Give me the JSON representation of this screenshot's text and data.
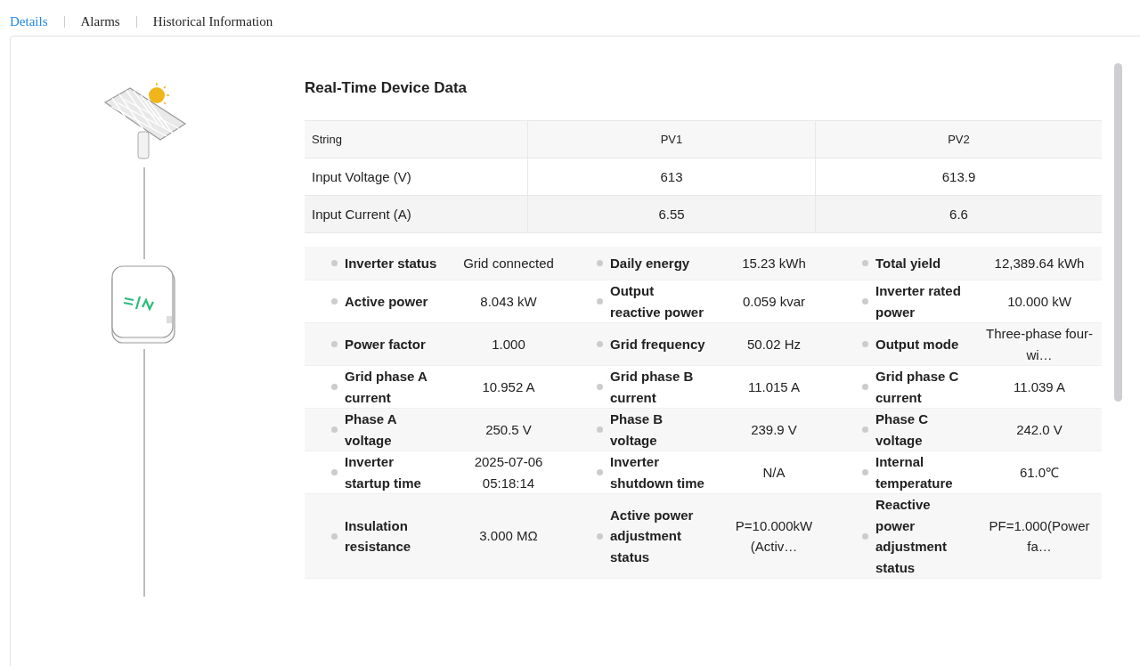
{
  "tabs": [
    {
      "label": "Details",
      "selected": true
    },
    {
      "label": "Alarms",
      "selected": false
    },
    {
      "label": "Historical Information",
      "selected": false
    }
  ],
  "title": "Real-Time Device Data",
  "string_table": {
    "columns": [
      "String",
      "PV1",
      "PV2"
    ],
    "rows": [
      [
        "Input Voltage (V)",
        "613",
        "613.9"
      ],
      [
        "Input Current (A)",
        "6.55",
        "6.6"
      ]
    ]
  },
  "parameters": [
    [
      {
        "label": "Inverter status",
        "value": "Grid connected"
      },
      {
        "label": "Daily energy",
        "value": "15.23 kWh"
      },
      {
        "label": "Total yield",
        "value": "12,389.64 kWh"
      }
    ],
    [
      {
        "label": "Active power",
        "value": "8.043 kW"
      },
      {
        "label": "Output reactive power",
        "value": "0.059 kvar"
      },
      {
        "label": "Inverter rated power",
        "value": "10.000 kW"
      }
    ],
    [
      {
        "label": "Power factor",
        "value": "1.000"
      },
      {
        "label": "Grid frequency",
        "value": "50.02 Hz"
      },
      {
        "label": "Output mode",
        "value": "Three-phase four-wi…"
      }
    ],
    [
      {
        "label": "Grid phase A current",
        "value": "10.952 A"
      },
      {
        "label": "Grid phase B current",
        "value": "11.015 A"
      },
      {
        "label": "Grid phase C current",
        "value": "11.039 A"
      }
    ],
    [
      {
        "label": "Phase A voltage",
        "value": "250.5 V"
      },
      {
        "label": "Phase B voltage",
        "value": "239.9 V"
      },
      {
        "label": "Phase C voltage",
        "value": "242.0 V"
      }
    ],
    [
      {
        "label": "Inverter startup time",
        "value": "2025-07-06 05:18:14"
      },
      {
        "label": "Inverter shutdown time",
        "value": "N/A"
      },
      {
        "label": "Internal temperature",
        "value": "61.0℃"
      }
    ],
    [
      {
        "label": "Insulation resistance",
        "value": "3.000 MΩ"
      },
      {
        "label": "Active power adjustment status",
        "value": "P=10.000kW (Activ…"
      },
      {
        "label": "Reactive power adjustment status",
        "value": "PF=1.000(Power fa…"
      }
    ]
  ]
}
